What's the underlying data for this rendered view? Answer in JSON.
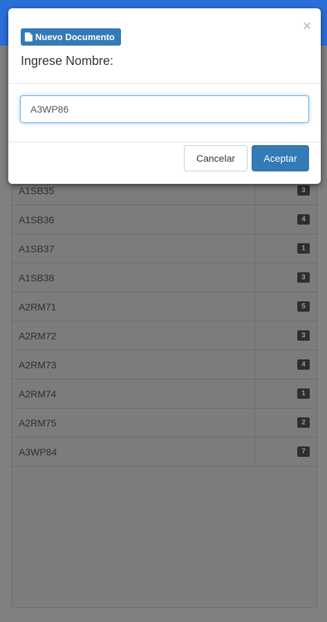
{
  "modal": {
    "tag_label": "Nuevo Documento",
    "title": "Ingrese Nombre:",
    "close_symbol": "×",
    "input_value": "A3WP86",
    "cancel_label": "Cancelar",
    "ok_label": "Aceptar"
  },
  "list": {
    "items": [
      {
        "name": "A1SB35",
        "count": "3"
      },
      {
        "name": "A1SB36",
        "count": "4"
      },
      {
        "name": "A1SB37",
        "count": "1"
      },
      {
        "name": "A1SB38",
        "count": "3"
      },
      {
        "name": "A2RM71",
        "count": "5"
      },
      {
        "name": "A2RM72",
        "count": "3"
      },
      {
        "name": "A2RM73",
        "count": "4"
      },
      {
        "name": "A2RM74",
        "count": "1"
      },
      {
        "name": "A2RM75",
        "count": "2"
      },
      {
        "name": "A3WP84",
        "count": "7"
      }
    ]
  },
  "colors": {
    "topbar": "#2a6fd8",
    "primary": "#337ab7",
    "backdrop": "#808080"
  }
}
